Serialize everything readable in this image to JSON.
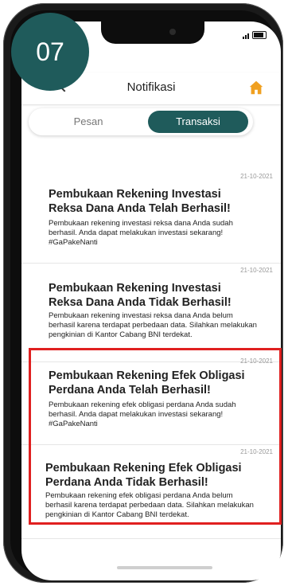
{
  "step_badge": "07",
  "header": {
    "title": "Notifikasi"
  },
  "tabs": [
    {
      "label": "Pesan",
      "active": false
    },
    {
      "label": "Transaksi",
      "active": true
    }
  ],
  "notifications": [
    {
      "date": "21-10-2021",
      "title": "Pembukaan Rekening Investasi Reksa Dana Anda Telah Berhasil!",
      "body": "Pembukaan rekening investasi reksa dana Anda sudah berhasil. Anda dapat melakukan investasi sekarang! #GaPakeNanti"
    },
    {
      "date": "21-10-2021",
      "title": "Pembukaan Rekening Investasi Reksa Dana Anda Tidak Berhasil!",
      "body": "Pembukaan rekening investasi reksa dana Anda belum berhasil karena terdapat perbedaan data. Silahkan melakukan pengkinian di Kantor Cabang BNI terdekat."
    },
    {
      "date": "21-10-2021",
      "title": "Pembukaan Rekening Efek Obligasi Perdana Anda Telah Berhasil!",
      "body": "Pembukaan rekening efek obligasi perdana Anda sudah berhasil. Anda dapat melakukan investasi sekarang! #GaPakeNanti"
    },
    {
      "date": "21-10-2021",
      "title": "Pembukaan Rekening Efek Obligasi Perdana Anda Tidak Berhasil!",
      "body": "Pembukaan rekening efek obligasi perdana Anda belum berhasil karena terdapat perbedaan data. Silahkan melakukan pengkinian di Kantor Cabang BNI terdekat."
    }
  ],
  "colors": {
    "accent": "#1f5b5b",
    "highlight": "#e02020",
    "home_icon": "#f0a020"
  }
}
